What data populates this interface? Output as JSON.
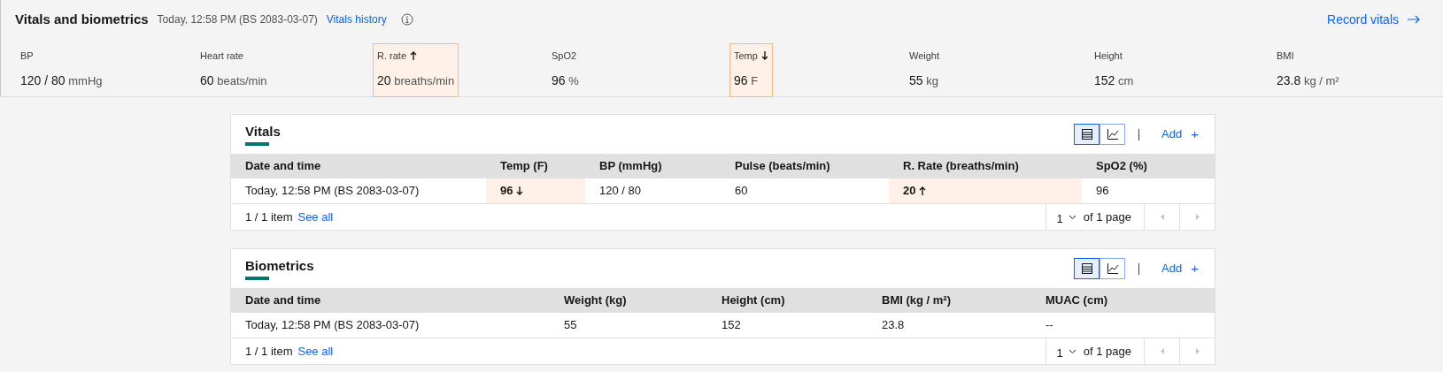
{
  "header": {
    "title": "Vitals and biometrics",
    "timestamp": "Today, 12:58 PM (BS 2083-03-07)",
    "history_link": "Vitals history",
    "record_link": "Record vitals"
  },
  "metrics": [
    {
      "label": "BP",
      "value": "120 / 80",
      "unit": "mmHg",
      "high": false,
      "low": false
    },
    {
      "label": "Heart rate",
      "value": "60",
      "unit": "beats/min",
      "high": false,
      "low": false
    },
    {
      "label": "R. rate",
      "value": "20",
      "unit": "breaths/min",
      "high": true,
      "low": false
    },
    {
      "label": "SpO2",
      "value": "96",
      "unit": "%",
      "high": false,
      "low": false
    },
    {
      "label": "Temp",
      "value": "96",
      "unit": "F",
      "high": false,
      "low": true
    },
    {
      "label": "Weight",
      "value": "55",
      "unit": "kg",
      "high": false,
      "low": false
    },
    {
      "label": "Height",
      "value": "152",
      "unit": "cm",
      "high": false,
      "low": false
    },
    {
      "label": "BMI",
      "value": "23.8",
      "unit": "kg / m²",
      "high": false,
      "low": false
    }
  ],
  "cards": [
    {
      "title": "Vitals",
      "views": [
        {
          "kind": "table",
          "selected": true
        },
        {
          "kind": "chart",
          "selected": false
        }
      ],
      "add_label": "Add",
      "add_icon": "+",
      "columns": [
        "Date and time",
        "Temp (F)",
        "BP (mmHg)",
        "Pulse (beats/min)",
        "R. Rate (breaths/min)",
        "SpO2 (%)"
      ],
      "rows": [
        [
          {
            "text": "Today, 12:58 PM (BS 2083-03-07)",
            "high": false,
            "low": false
          },
          {
            "text": "96",
            "high": false,
            "low": true
          },
          {
            "text": "120 / 80",
            "high": false,
            "low": false
          },
          {
            "text": "60",
            "high": false,
            "low": false
          },
          {
            "text": "20",
            "high": true,
            "low": false
          },
          {
            "text": "96",
            "high": false,
            "low": false
          }
        ]
      ],
      "footer": {
        "count": "1 / 1 item",
        "see_all": "See all",
        "page": "1",
        "page_of": "of 1 page"
      }
    },
    {
      "title": "Biometrics",
      "views": [
        {
          "kind": "table",
          "selected": true
        },
        {
          "kind": "chart",
          "selected": false
        }
      ],
      "add_label": "Add",
      "add_icon": "+",
      "columns": [
        "Date and time",
        "Weight (kg)",
        "Height (cm)",
        "BMI (kg / m²)",
        "MUAC (cm)"
      ],
      "rows": [
        [
          {
            "text": "Today, 12:58 PM (BS 2083-03-07)",
            "high": false,
            "low": false
          },
          {
            "text": "55",
            "high": false,
            "low": false
          },
          {
            "text": "152",
            "high": false,
            "low": false
          },
          {
            "text": "23.8",
            "high": false,
            "low": false
          },
          {
            "text": "--",
            "high": false,
            "low": false
          }
        ]
      ],
      "footer": {
        "count": "1 / 1 item",
        "see_all": "See all",
        "page": "1",
        "page_of": "of 1 page"
      }
    }
  ]
}
